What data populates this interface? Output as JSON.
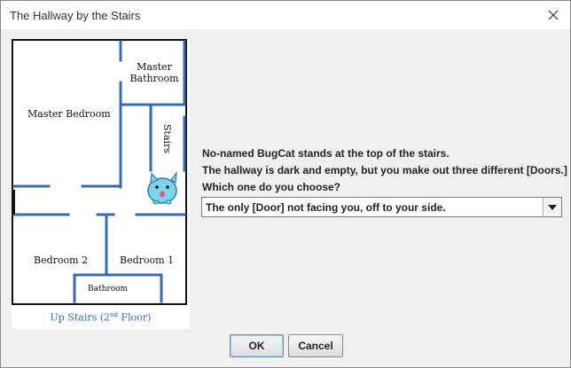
{
  "window": {
    "title": "The Hallway by the Stairs"
  },
  "map": {
    "rooms": {
      "master_bathroom_line1": "Master",
      "master_bathroom_line2": "Bathroom",
      "master_bedroom": "Master Bedroom",
      "stairs": "Stairs",
      "bedroom_2": "Bedroom 2",
      "bedroom_1": "Bedroom 1",
      "bathroom": "Bathroom"
    },
    "caption_prefix": "Up Stairs (2",
    "caption_sup": "nd",
    "caption_suffix": " Floor)",
    "wall_color": "#3a6bb0",
    "character_color": "#7fd3ee"
  },
  "prompt": {
    "line1": "No-named BugCat stands at the top of the stairs.",
    "line2": "The hallway is dark and empty, but you make out three different [Doors.]",
    "line3": "Which one do you choose?"
  },
  "choice": {
    "selected": "The only [Door] not facing you, off to your side."
  },
  "buttons": {
    "ok": "OK",
    "cancel": "Cancel"
  }
}
